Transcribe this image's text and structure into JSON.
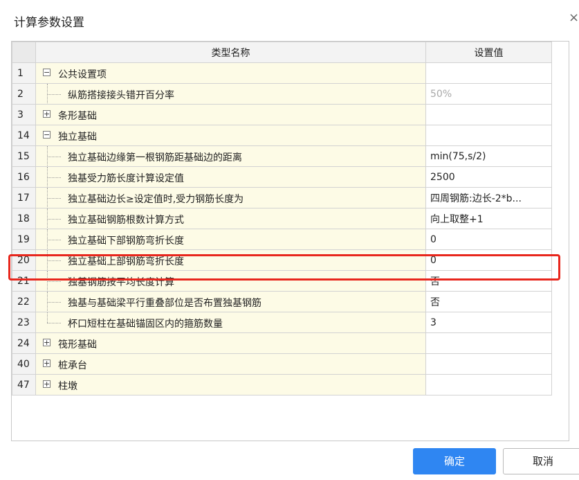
{
  "dialog": {
    "title": "计算参数设置",
    "close_glyph": "×"
  },
  "table": {
    "col_name": "类型名称",
    "col_value": "设置值",
    "rows": [
      {
        "num": "1",
        "kind": "group",
        "state": "−",
        "label": "公共设置项",
        "value": ""
      },
      {
        "num": "2",
        "kind": "child",
        "label": "纵筋搭接接头错开百分率",
        "value": "50%",
        "grey": true
      },
      {
        "num": "3",
        "kind": "group",
        "state": "+",
        "label": "条形基础",
        "value": ""
      },
      {
        "num": "14",
        "kind": "group",
        "state": "−",
        "label": "独立基础",
        "value": ""
      },
      {
        "num": "15",
        "kind": "child",
        "label": "独立基础边缘第一根钢筋距基础边的距离",
        "value": "min(75,s/2)"
      },
      {
        "num": "16",
        "kind": "child",
        "label": "独基受力筋长度计算设定值",
        "value": "2500"
      },
      {
        "num": "17",
        "kind": "child",
        "label": "独立基础边长≥设定值时,受力钢筋长度为",
        "value": "四周钢筋:边长-2*b..."
      },
      {
        "num": "18",
        "kind": "child",
        "label": "独立基础钢筋根数计算方式",
        "value": "向上取整+1"
      },
      {
        "num": "19",
        "kind": "child",
        "label": "独立基础下部钢筋弯折长度",
        "value": "0"
      },
      {
        "num": "20",
        "kind": "child",
        "label": "独立基础上部钢筋弯折长度",
        "value": "0"
      },
      {
        "num": "21",
        "kind": "child",
        "label": "独基钢筋按平均长度计算",
        "value": "否"
      },
      {
        "num": "22",
        "kind": "child",
        "label": "独基与基础梁平行重叠部位是否布置独基钢筋",
        "value": "否"
      },
      {
        "num": "23",
        "kind": "child",
        "label": "杯口短柱在基础锚固区内的箍筋数量",
        "value": "3",
        "last": true
      },
      {
        "num": "24",
        "kind": "group",
        "state": "+",
        "label": "筏形基础",
        "value": ""
      },
      {
        "num": "40",
        "kind": "group",
        "state": "+",
        "label": "桩承台",
        "value": ""
      },
      {
        "num": "47",
        "kind": "group",
        "state": "+",
        "label": "柱墩",
        "value": ""
      }
    ]
  },
  "buttons": {
    "ok": "确定",
    "cancel": "取消"
  },
  "colors": {
    "highlight": "#e8261c",
    "primary": "#2f86f2",
    "name_cell_bg": "#fdfbe6"
  }
}
